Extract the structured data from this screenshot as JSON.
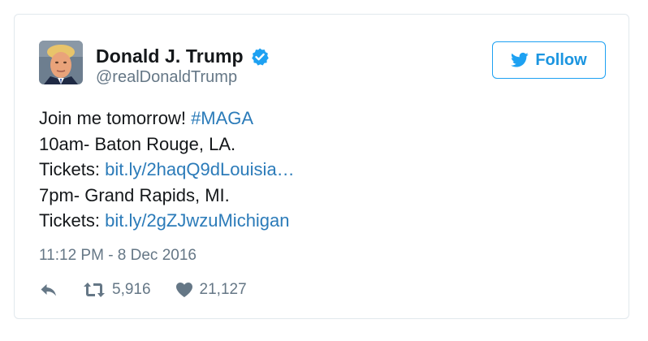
{
  "author": {
    "name": "Donald J. Trump",
    "handle": "@realDonaldTrump",
    "verified": true
  },
  "follow_button": {
    "label": "Follow"
  },
  "tweet": {
    "line1_text": "Join me tomorrow! ",
    "line1_hashtag": "#MAGA",
    "line2": "10am- Baton Rouge, LA.",
    "line3_text": "Tickets: ",
    "line3_link": "bit.ly/2haqQ9dLouisia…",
    "line4": "7pm- Grand Rapids, MI.",
    "line5_text": "Tickets: ",
    "line5_link": "bit.ly/2gZJwzuMichigan"
  },
  "timestamp": "11:12 PM - 8 Dec 2016",
  "actions": {
    "retweets": "5,916",
    "likes": "21,127"
  },
  "colors": {
    "link": "#2b7bb9",
    "verified": "#1da1f2",
    "secondary_text": "#657786",
    "primary_text": "#14171a",
    "border": "#e1e8ed"
  },
  "icons": {
    "reply": "reply-icon",
    "retweet": "retweet-icon",
    "like": "heart-icon",
    "verified": "verified-badge-icon",
    "follow": "twitter-bird-icon"
  }
}
